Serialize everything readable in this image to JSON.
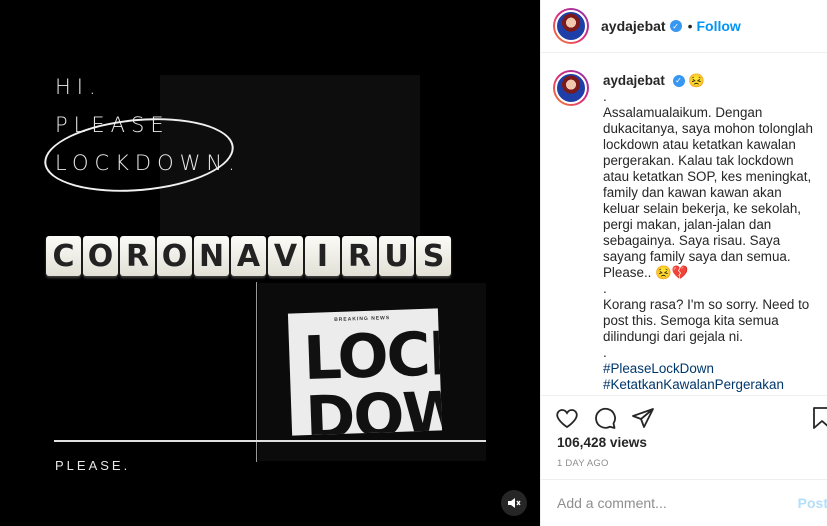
{
  "media": {
    "hi_lines": [
      "HI.",
      "PLEASE",
      "LOCKDOWN."
    ],
    "tiles": [
      "C",
      "O",
      "R",
      "O",
      "N",
      "A",
      "V",
      "I",
      "R",
      "U",
      "S"
    ],
    "newspaper_kicker": "BREAKING NEWS",
    "newspaper_headline": "LOCK DOWN",
    "bottom_text": "PLEASE.",
    "sound_icon": "speaker-muted-icon"
  },
  "header": {
    "username": "aydajebat",
    "separator": "•",
    "follow_label": "Follow"
  },
  "caption": {
    "username": "aydajebat",
    "emoji": "😣",
    "paragraphs": [
      ".",
      "Assalamualaikum. Dengan dukacitanya, saya mohon tolonglah lockdown atau ketatkan kawalan pergerakan. Kalau tak lockdown atau ketatkan SOP, kes meningkat, family dan kawan kawan akan keluar selain bekerja, ke sekolah, pergi makan, jalan-jalan dan sebagainya. Saya risau. Saya sayang family saya dan semua. Please.. 😣💔",
      ".",
      "Korang rasa? I'm so sorry. Need to post this. Semoga kita semua dilindungi dari gejala ni.",
      "."
    ],
    "hashtags": [
      "#PleaseLockDown",
      "#KetatkanKawalanPergerakan"
    ]
  },
  "actions": {
    "icons": [
      "heart-icon",
      "comment-icon",
      "share-icon",
      "save-icon"
    ]
  },
  "stats": {
    "views": "106,428 views",
    "date": "1 DAY AGO"
  },
  "comment": {
    "placeholder": "Add a comment...",
    "post_label": "Post"
  },
  "colors": {
    "accent": "#0095f6",
    "verified": "#3897f0",
    "post_disabled": "#b2dffc",
    "hashtag": "#00376b"
  }
}
